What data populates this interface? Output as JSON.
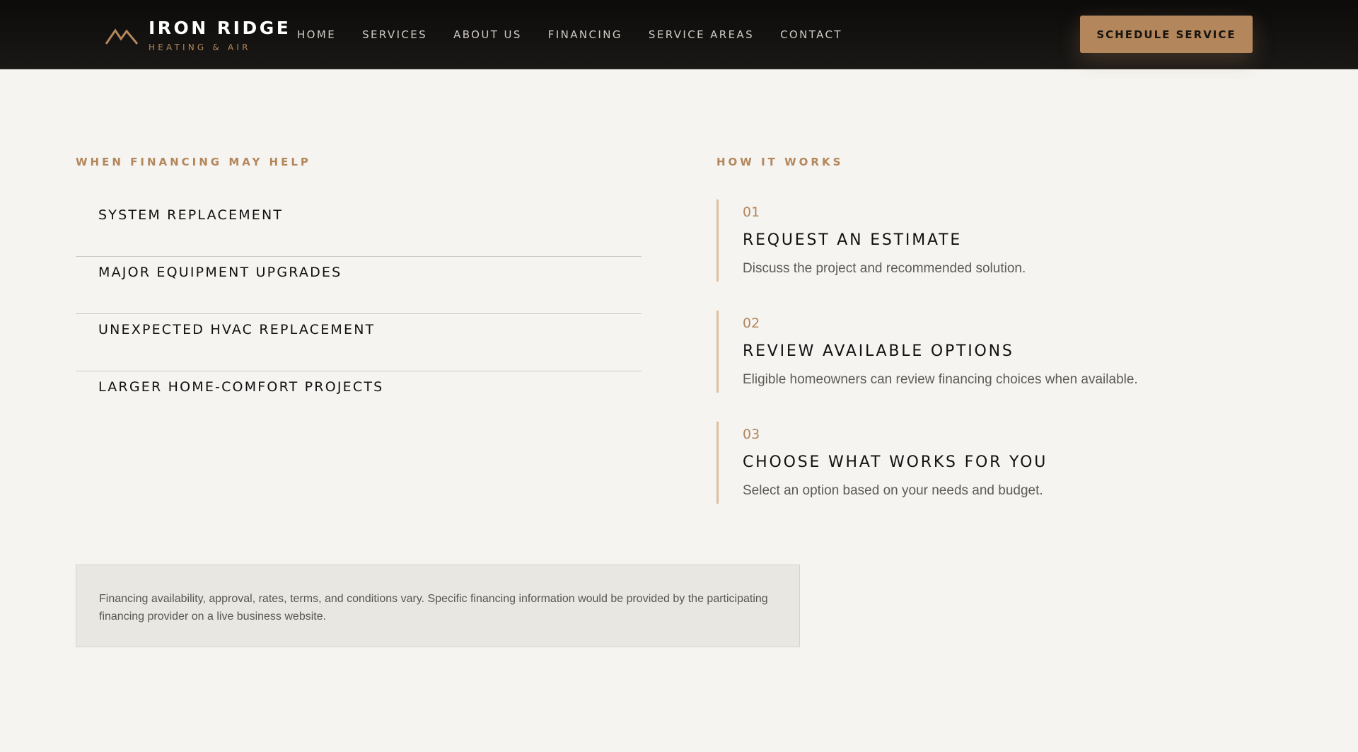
{
  "header": {
    "brand_name": "IRON RIDGE",
    "brand_tag": "HEATING & AIR",
    "logo_icon": "mountain-icon",
    "nav": [
      {
        "label": "HOME"
      },
      {
        "label": "SERVICES"
      },
      {
        "label": "ABOUT US"
      },
      {
        "label": "FINANCING"
      },
      {
        "label": "SERVICE AREAS"
      },
      {
        "label": "CONTACT"
      }
    ],
    "cta_label": "SCHEDULE SERVICE"
  },
  "financing": {
    "eyebrow": "WHEN FINANCING MAY HELP",
    "items": [
      {
        "label": "SYSTEM REPLACEMENT"
      },
      {
        "label": "MAJOR EQUIPMENT UPGRADES"
      },
      {
        "label": "UNEXPECTED HVAC REPLACEMENT"
      },
      {
        "label": "LARGER HOME-COMFORT PROJECTS"
      }
    ]
  },
  "how_it_works": {
    "eyebrow": "HOW IT WORKS",
    "steps": [
      {
        "num": "01",
        "title": "REQUEST AN ESTIMATE",
        "desc": "Discuss the project and recommended solution."
      },
      {
        "num": "02",
        "title": "REVIEW AVAILABLE OPTIONS",
        "desc": "Eligible homeowners can review financing choices when available."
      },
      {
        "num": "03",
        "title": "CHOOSE WHAT WORKS FOR YOU",
        "desc": "Select an option based on your needs and budget."
      }
    ]
  },
  "disclaimer": {
    "text": "Financing availability, approval, rates, terms, and conditions vary. Specific financing information would be provided by the participating financing provider on a live business website."
  },
  "colors": {
    "accent": "#b3865b",
    "header_bg": "#0c0b0a",
    "page_bg": "#f5f4f0",
    "step_border": "#e0bfa0"
  }
}
